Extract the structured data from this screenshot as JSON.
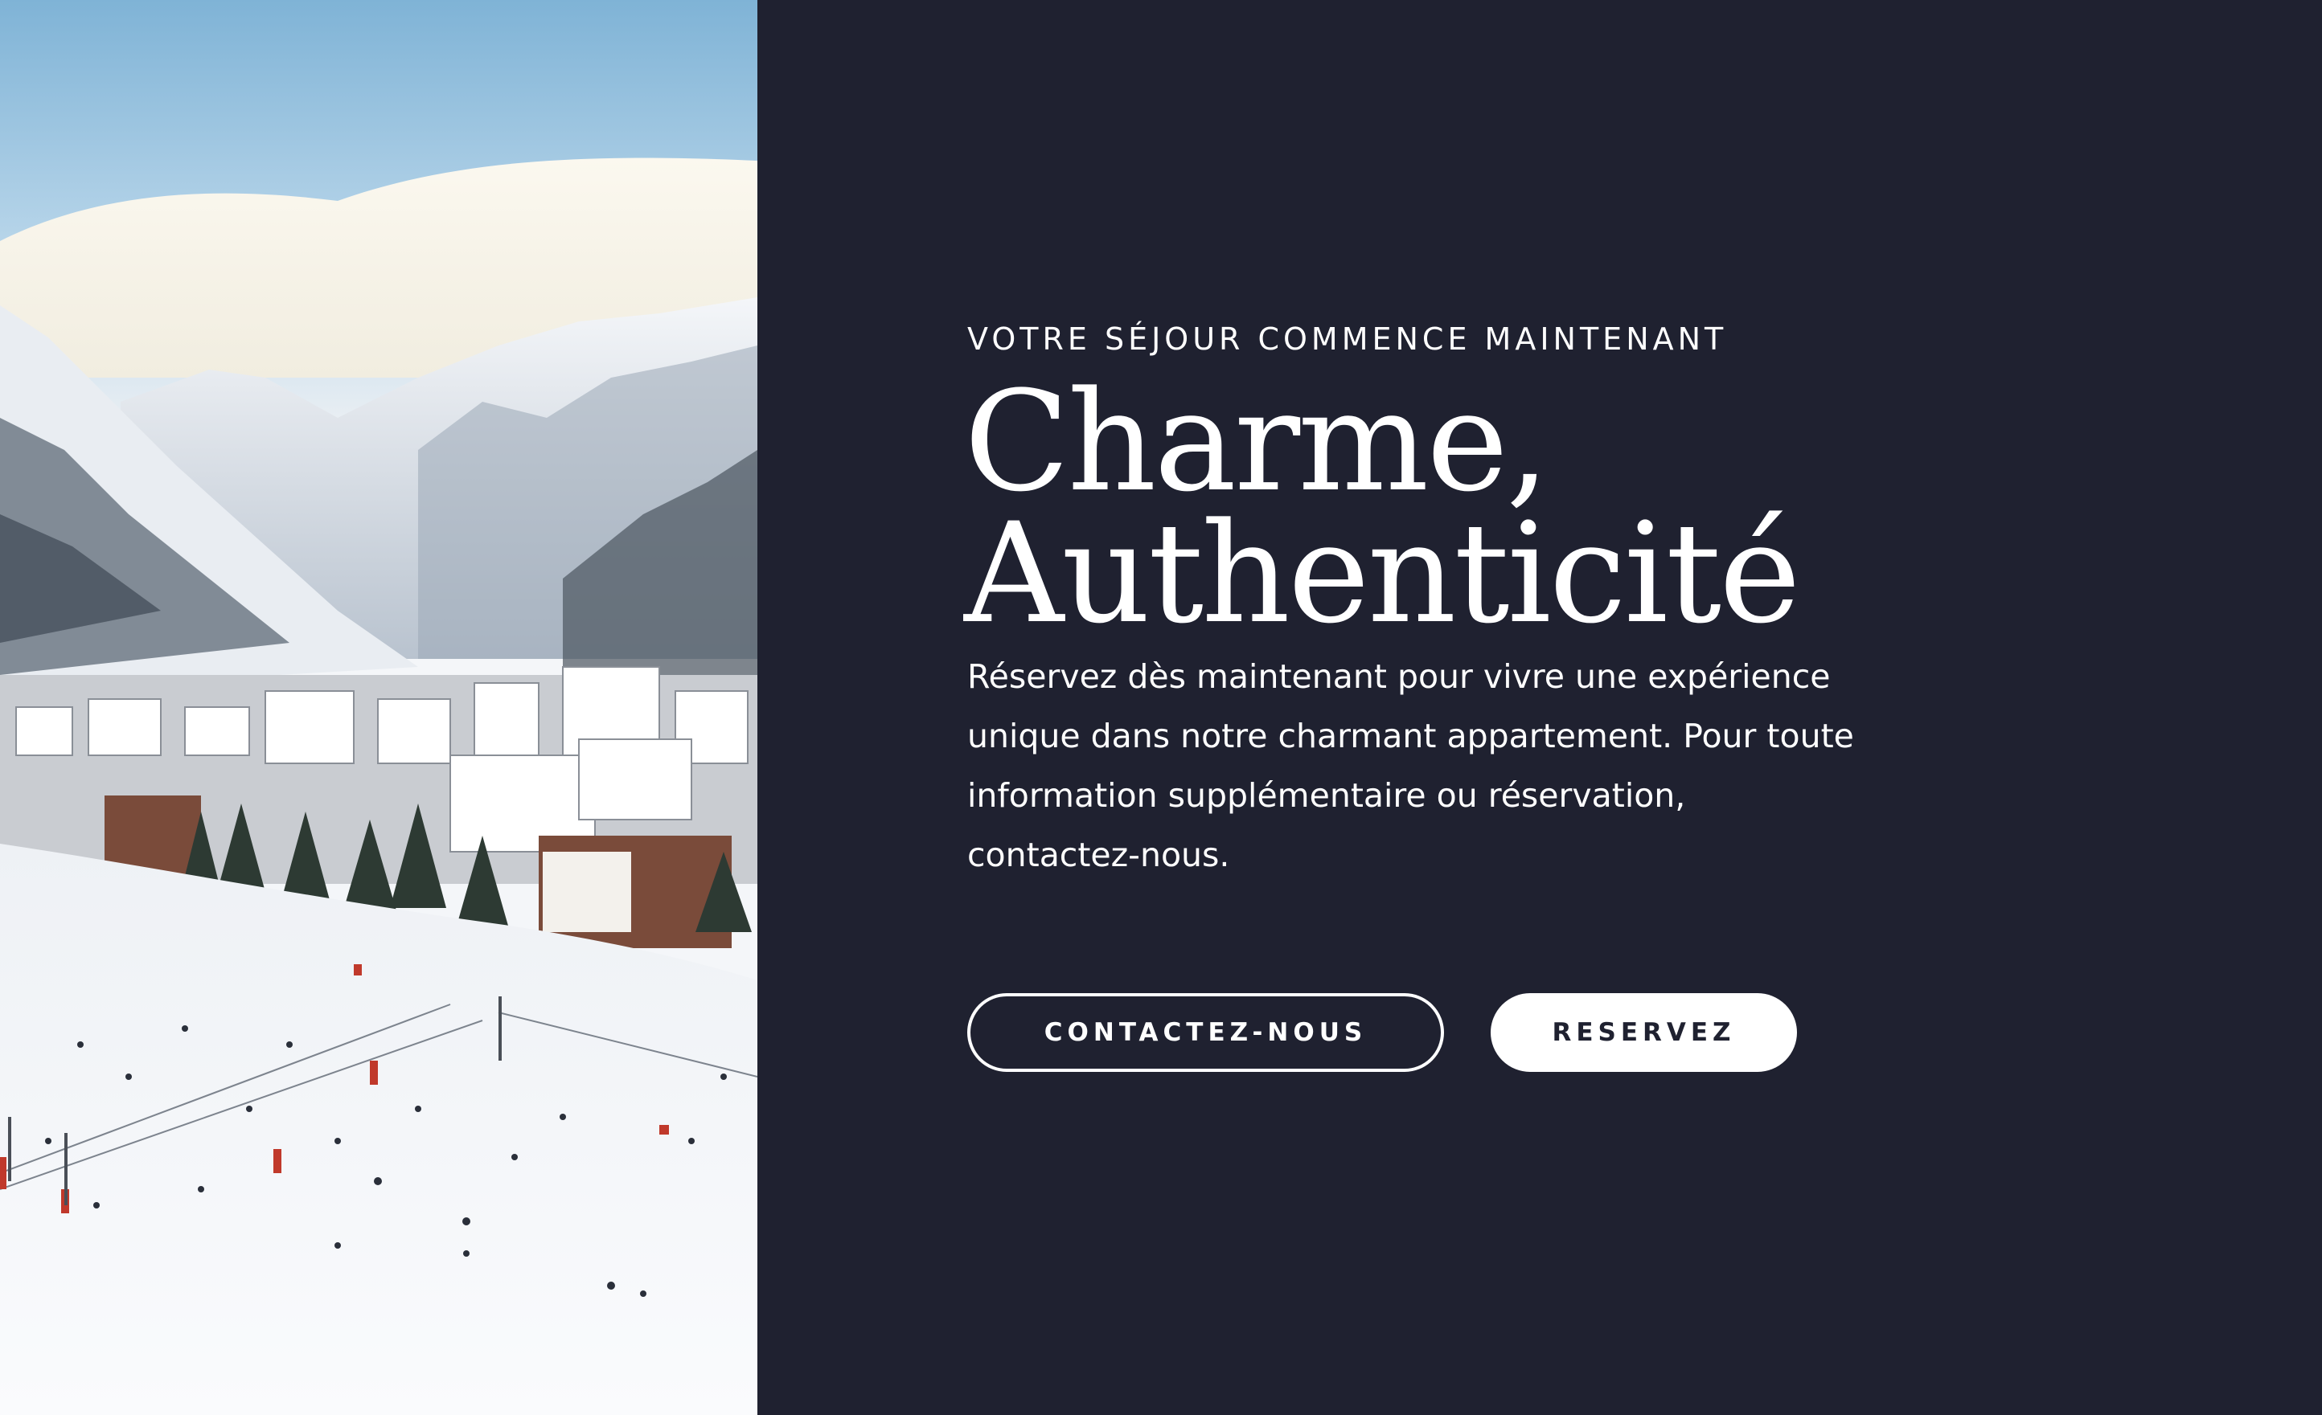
{
  "hero": {
    "eyebrow": "VOTRE SÉJOUR COMMENCE MAINTENANT",
    "headline_line1": "Charme,",
    "headline_line2": "Authenticité",
    "lead": "Réservez dès maintenant pour vivre une expérience unique dans notre charmant appartement. Pour toute information supplémentaire ou réservation, contactez-nous."
  },
  "actions": {
    "contact_label": "CONTACTEZ-NOUS",
    "reserve_label": "RESERVEZ"
  },
  "image": {
    "alt": "Station de ski enneigée au pied des montagnes"
  },
  "colors": {
    "background": "#1f2130",
    "text": "#ffffff",
    "button_solid_bg": "#ffffff",
    "button_solid_text": "#1f2130"
  }
}
